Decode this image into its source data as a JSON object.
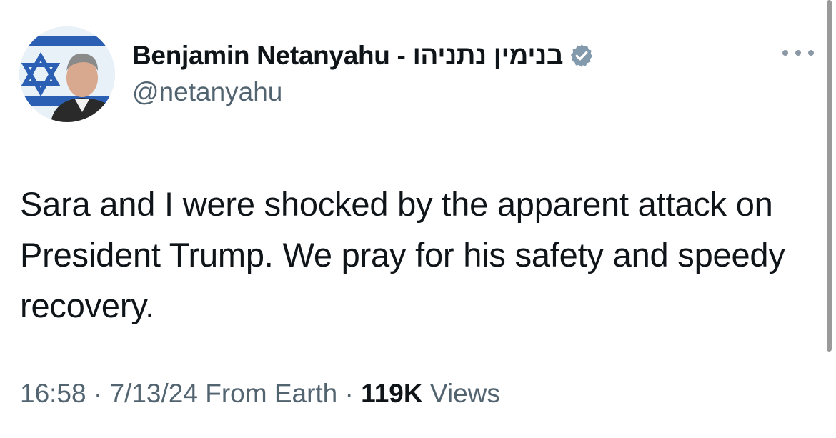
{
  "author": {
    "display_name": "Benjamin Netanyahu - בנימין נתניהו",
    "handle": "@netanyahu",
    "verified_icon": "verified-badge-icon",
    "avatar_icon": "profile-avatar"
  },
  "tweet": {
    "text": "Sara and I were shocked by the apparent attack on President Trump. We pray for his safety and speedy recovery.",
    "time": "16:58",
    "date": "7/13/24",
    "source": "From Earth",
    "views_count": "119K",
    "views_label": "Views",
    "separator": "·"
  },
  "colors": {
    "text_primary": "#0f1419",
    "text_secondary": "#536471",
    "verified_badge": "#829aab"
  },
  "menu": {
    "icon": "more-options-icon"
  }
}
